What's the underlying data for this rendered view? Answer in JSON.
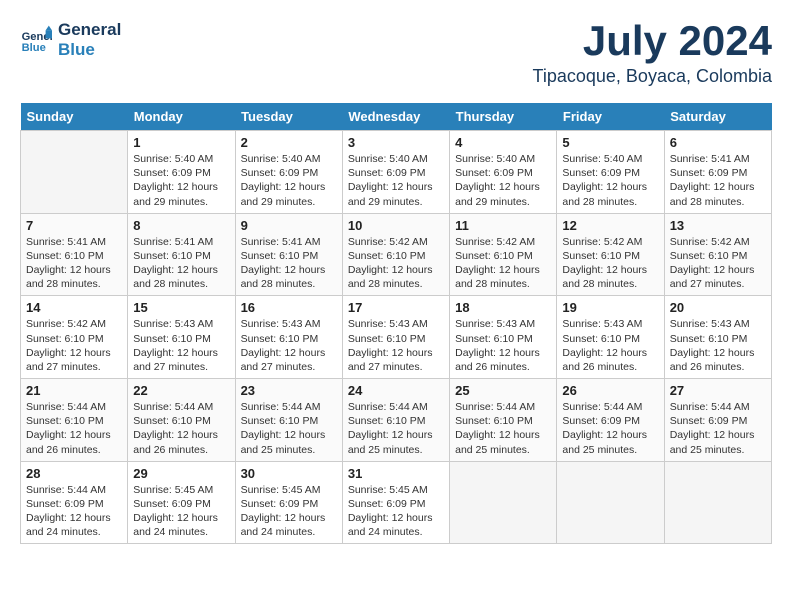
{
  "header": {
    "logo_line1": "General",
    "logo_line2": "Blue",
    "month": "July 2024",
    "location": "Tipacoque, Boyaca, Colombia"
  },
  "days_of_week": [
    "Sunday",
    "Monday",
    "Tuesday",
    "Wednesday",
    "Thursday",
    "Friday",
    "Saturday"
  ],
  "weeks": [
    [
      {
        "day": "",
        "info": ""
      },
      {
        "day": "1",
        "info": "Sunrise: 5:40 AM\nSunset: 6:09 PM\nDaylight: 12 hours\nand 29 minutes."
      },
      {
        "day": "2",
        "info": "Sunrise: 5:40 AM\nSunset: 6:09 PM\nDaylight: 12 hours\nand 29 minutes."
      },
      {
        "day": "3",
        "info": "Sunrise: 5:40 AM\nSunset: 6:09 PM\nDaylight: 12 hours\nand 29 minutes."
      },
      {
        "day": "4",
        "info": "Sunrise: 5:40 AM\nSunset: 6:09 PM\nDaylight: 12 hours\nand 29 minutes."
      },
      {
        "day": "5",
        "info": "Sunrise: 5:40 AM\nSunset: 6:09 PM\nDaylight: 12 hours\nand 28 minutes."
      },
      {
        "day": "6",
        "info": "Sunrise: 5:41 AM\nSunset: 6:09 PM\nDaylight: 12 hours\nand 28 minutes."
      }
    ],
    [
      {
        "day": "7",
        "info": "Sunrise: 5:41 AM\nSunset: 6:10 PM\nDaylight: 12 hours\nand 28 minutes."
      },
      {
        "day": "8",
        "info": "Sunrise: 5:41 AM\nSunset: 6:10 PM\nDaylight: 12 hours\nand 28 minutes."
      },
      {
        "day": "9",
        "info": "Sunrise: 5:41 AM\nSunset: 6:10 PM\nDaylight: 12 hours\nand 28 minutes."
      },
      {
        "day": "10",
        "info": "Sunrise: 5:42 AM\nSunset: 6:10 PM\nDaylight: 12 hours\nand 28 minutes."
      },
      {
        "day": "11",
        "info": "Sunrise: 5:42 AM\nSunset: 6:10 PM\nDaylight: 12 hours\nand 28 minutes."
      },
      {
        "day": "12",
        "info": "Sunrise: 5:42 AM\nSunset: 6:10 PM\nDaylight: 12 hours\nand 28 minutes."
      },
      {
        "day": "13",
        "info": "Sunrise: 5:42 AM\nSunset: 6:10 PM\nDaylight: 12 hours\nand 27 minutes."
      }
    ],
    [
      {
        "day": "14",
        "info": "Sunrise: 5:42 AM\nSunset: 6:10 PM\nDaylight: 12 hours\nand 27 minutes."
      },
      {
        "day": "15",
        "info": "Sunrise: 5:43 AM\nSunset: 6:10 PM\nDaylight: 12 hours\nand 27 minutes."
      },
      {
        "day": "16",
        "info": "Sunrise: 5:43 AM\nSunset: 6:10 PM\nDaylight: 12 hours\nand 27 minutes."
      },
      {
        "day": "17",
        "info": "Sunrise: 5:43 AM\nSunset: 6:10 PM\nDaylight: 12 hours\nand 27 minutes."
      },
      {
        "day": "18",
        "info": "Sunrise: 5:43 AM\nSunset: 6:10 PM\nDaylight: 12 hours\nand 26 minutes."
      },
      {
        "day": "19",
        "info": "Sunrise: 5:43 AM\nSunset: 6:10 PM\nDaylight: 12 hours\nand 26 minutes."
      },
      {
        "day": "20",
        "info": "Sunrise: 5:43 AM\nSunset: 6:10 PM\nDaylight: 12 hours\nand 26 minutes."
      }
    ],
    [
      {
        "day": "21",
        "info": "Sunrise: 5:44 AM\nSunset: 6:10 PM\nDaylight: 12 hours\nand 26 minutes."
      },
      {
        "day": "22",
        "info": "Sunrise: 5:44 AM\nSunset: 6:10 PM\nDaylight: 12 hours\nand 26 minutes."
      },
      {
        "day": "23",
        "info": "Sunrise: 5:44 AM\nSunset: 6:10 PM\nDaylight: 12 hours\nand 25 minutes."
      },
      {
        "day": "24",
        "info": "Sunrise: 5:44 AM\nSunset: 6:10 PM\nDaylight: 12 hours\nand 25 minutes."
      },
      {
        "day": "25",
        "info": "Sunrise: 5:44 AM\nSunset: 6:10 PM\nDaylight: 12 hours\nand 25 minutes."
      },
      {
        "day": "26",
        "info": "Sunrise: 5:44 AM\nSunset: 6:09 PM\nDaylight: 12 hours\nand 25 minutes."
      },
      {
        "day": "27",
        "info": "Sunrise: 5:44 AM\nSunset: 6:09 PM\nDaylight: 12 hours\nand 25 minutes."
      }
    ],
    [
      {
        "day": "28",
        "info": "Sunrise: 5:44 AM\nSunset: 6:09 PM\nDaylight: 12 hours\nand 24 minutes."
      },
      {
        "day": "29",
        "info": "Sunrise: 5:45 AM\nSunset: 6:09 PM\nDaylight: 12 hours\nand 24 minutes."
      },
      {
        "day": "30",
        "info": "Sunrise: 5:45 AM\nSunset: 6:09 PM\nDaylight: 12 hours\nand 24 minutes."
      },
      {
        "day": "31",
        "info": "Sunrise: 5:45 AM\nSunset: 6:09 PM\nDaylight: 12 hours\nand 24 minutes."
      },
      {
        "day": "",
        "info": ""
      },
      {
        "day": "",
        "info": ""
      },
      {
        "day": "",
        "info": ""
      }
    ]
  ]
}
